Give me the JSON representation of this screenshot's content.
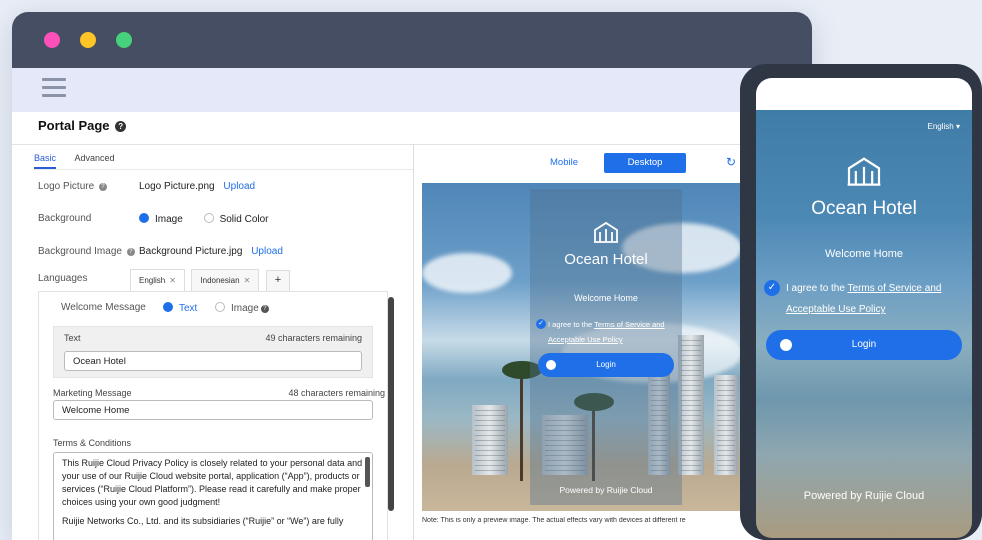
{
  "page": {
    "title": "Portal Page"
  },
  "tabs": [
    {
      "label": "Basic"
    },
    {
      "label": "Advanced"
    }
  ],
  "basic": {
    "logo_label": "Logo Picture",
    "logo_file": "Logo Picture.png",
    "upload_label": "Upload",
    "background_label": "Background",
    "background_options": [
      "Image",
      "Solid Color"
    ],
    "background_selected": "Image",
    "bg_image_label": "Background Image",
    "bg_image_file": "Background Picture.jpg",
    "languages_label": "Languages",
    "language_tabs": [
      "English",
      "Indonesian"
    ],
    "add_tab": "+"
  },
  "welcome": {
    "label": "Welcome Message",
    "options": [
      "Text",
      "Image"
    ],
    "selected": "Text",
    "text_label": "Text",
    "text_remaining": "49  characters remaining",
    "text_value": "Ocean Hotel"
  },
  "marketing": {
    "label": "Marketing Message",
    "remaining": "48  characters remaining",
    "value": "Welcome Home"
  },
  "terms": {
    "label": "Terms & Conditions",
    "body": "This Ruijie Cloud Privacy Policy is closely related to your personal data and your use of our Ruijie Cloud website portal, application (“App”), products or services (“Ruijie Cloud Platform”). Please read it carefully and make proper choices using your own good judgment!",
    "body2": "Ruijie Networks Co., Ltd. and its subsidiaries (“Ruijie” or “We”) are fully"
  },
  "preview": {
    "mobile_label": "Mobile",
    "desktop_label": "Desktop",
    "refresh_icon": "↻",
    "hotel_name": "Ocean Hotel",
    "welcome": "Welcome Home",
    "agree_prefix": "I agree to the ",
    "agree_link1": "Terms of Service and",
    "agree_link2": "Acceptable Use Policy",
    "login": "Login",
    "powered": "Powered by Ruijie Cloud",
    "note": "Note: This is only a preview image. The actual effects vary with devices at different re"
  },
  "phone": {
    "language": "English ▾",
    "hotel_name": "Ocean Hotel",
    "welcome": "Welcome Home",
    "agree_prefix": "I agree to the ",
    "agree_link1": "Terms of Service and",
    "agree_link2": "Acceptable Use Policy",
    "login": "Login",
    "powered": "Powered by Ruijie Cloud"
  },
  "colors": {
    "accent": "#1f6fe8",
    "titlebar": "#454e63",
    "menubar": "#e4e8f8",
    "phone_frame": "#2f3745"
  }
}
